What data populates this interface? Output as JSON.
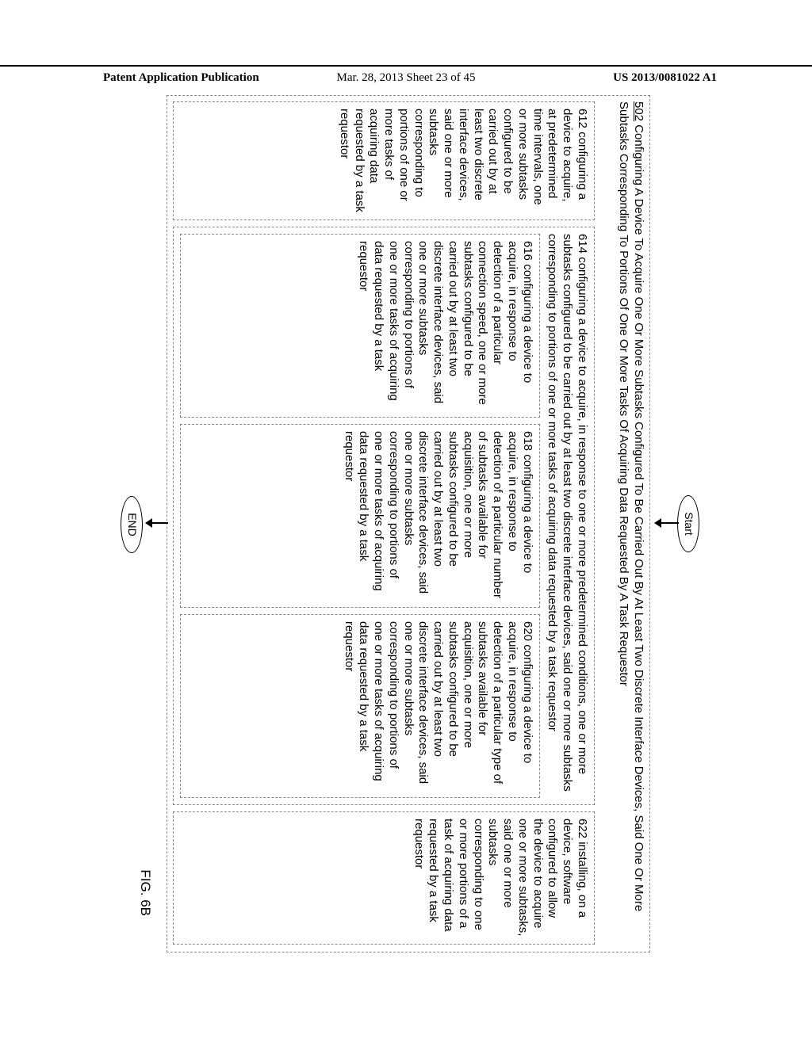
{
  "header": {
    "left": "Patent Application Publication",
    "center": "Mar. 28, 2013  Sheet 23 of 45",
    "right": "US 2013/0081022 A1"
  },
  "flow": {
    "start": "Start",
    "end": "END",
    "figure": "FIG. 6B"
  },
  "box502": {
    "num": "502",
    "text": " Configuring A Device To Acquire One Or More Subtasks Configured To Be Carried Out By At Least Two Discrete Interface Devices, Said One Or More Subtasks Corresponding To Portions Of One Or More Tasks Of Acquiring Data Requested By A Task Requestor"
  },
  "box612": "612 configuring a device to acquire, at predetermined time intervals, one or more subtasks configured to be carried out by at least two discrete interface devices, said one or more subtasks corresponding to portions of one or more tasks of acquiring data requested by a task requestor",
  "box614": "614 configuring a device to acquire, in response to one or more predetermined conditions, one or more subtasks configured to be carried out by at least two discrete interface devices, said one or more subtasks corresponding to portions of one or more tasks of acquiring data requested by a task requestor",
  "box616": "616 configuring a device to acquire, in response to detection of a particular connection speed, one or more subtasks configured to be carried out by at least two discrete interface devices, said one or more subtasks corresponding to portions of one or more tasks of acquiring data requested by a task requestor",
  "box618": "618 configuring a device to acquire, in response to detection of a particular number of subtasks available for acquisition, one or more subtasks configured to be carried out by at least two discrete interface devices, said one or more subtasks corresponding to portions of one or more tasks of acquiring data requested by a task requestor",
  "box620": "620 configuring a device to acquire, in response to detection of a particular type of subtasks available for acquisition, one or more subtasks configured to be carried out by at least two discrete interface devices, said one or more subtasks corresponding to portions of one or more tasks of acquiring data requested by a task requestor",
  "box622": "622 installing, on a device, software configured to allow the device to acquire one or more subtasks, said one or more subtasks corresponding to one or more portions of a task of acquiring data requested by a task requestor"
}
